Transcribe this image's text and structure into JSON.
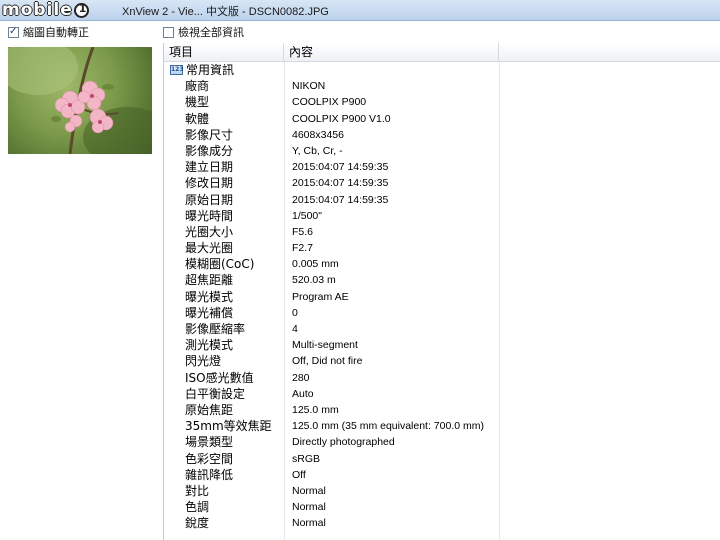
{
  "window": {
    "title": "XnView 2 - Vie... 中文版 - DSCN0082.JPG",
    "logo_text": "mobile01"
  },
  "options": {
    "auto_rotate_label": "縮圖自動轉正",
    "auto_rotate_checked": true,
    "show_all_label": "檢視全部資訊",
    "show_all_checked": false
  },
  "table": {
    "headers": {
      "item": "項目",
      "content": "內容",
      "extra": ""
    },
    "group_label": "常用資訊",
    "rows": [
      {
        "key": "廠商",
        "value": "NIKON"
      },
      {
        "key": "機型",
        "value": "COOLPIX P900"
      },
      {
        "key": "軟體",
        "value": "COOLPIX P900   V1.0"
      },
      {
        "key": "影像尺寸",
        "value": "4608x3456"
      },
      {
        "key": "影像成分",
        "value": "Y, Cb, Cr, -"
      },
      {
        "key": "建立日期",
        "value": "2015:04:07 14:59:35"
      },
      {
        "key": "修改日期",
        "value": "2015:04:07 14:59:35"
      },
      {
        "key": "原始日期",
        "value": "2015:04:07 14:59:35"
      },
      {
        "key": "曝光時間",
        "value": "1/500\""
      },
      {
        "key": "光圈大小",
        "value": "F5.6"
      },
      {
        "key": "最大光圈",
        "value": "F2.7"
      },
      {
        "key": "模糊圈(CoC)",
        "value": "0.005 mm"
      },
      {
        "key": "超焦距離",
        "value": "520.03 m"
      },
      {
        "key": "曝光模式",
        "value": "Program AE"
      },
      {
        "key": "曝光補償",
        "value": "0"
      },
      {
        "key": "影像壓縮率",
        "value": "4"
      },
      {
        "key": "測光模式",
        "value": "Multi-segment"
      },
      {
        "key": "閃光燈",
        "value": "Off, Did not fire"
      },
      {
        "key": "ISO感光數值",
        "value": "280"
      },
      {
        "key": "白平衡設定",
        "value": "Auto"
      },
      {
        "key": "原始焦距",
        "value": "125.0 mm"
      },
      {
        "key": "35mm等效焦距",
        "value": "125.0 mm (35 mm equivalent: 700.0 mm)"
      },
      {
        "key": "場景類型",
        "value": "Directly photographed"
      },
      {
        "key": "色彩空間",
        "value": "sRGB"
      },
      {
        "key": "雜訊降低",
        "value": "Off"
      },
      {
        "key": "對比",
        "value": "Normal"
      },
      {
        "key": "色調",
        "value": "Normal"
      },
      {
        "key": "銳度",
        "value": "Normal"
      }
    ]
  },
  "colors": {
    "titlebar": "#bcd2ec",
    "table_border": "#c7cdd4",
    "photo_background": "#7c9a4a",
    "blossom": "#f2b6c6"
  }
}
